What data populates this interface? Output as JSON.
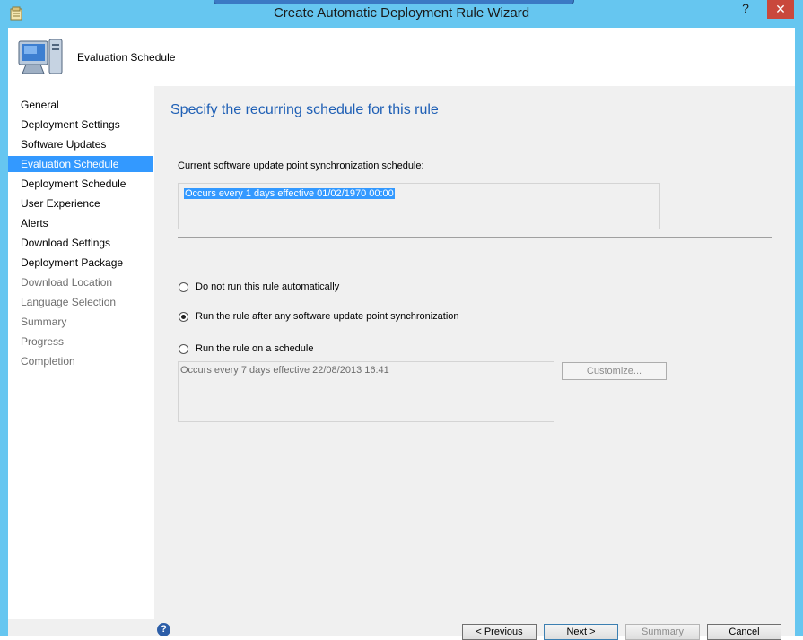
{
  "window": {
    "title": "Create Automatic Deployment Rule Wizard",
    "help_glyph": "?",
    "close_glyph": "✕",
    "frame_color": "#66c6f0",
    "accent_color": "#3399ff"
  },
  "header": {
    "title": "Evaluation Schedule",
    "icon": "computer-icon"
  },
  "nav": {
    "items": [
      {
        "label": "General",
        "state": "enabled"
      },
      {
        "label": "Deployment Settings",
        "state": "enabled"
      },
      {
        "label": "Software Updates",
        "state": "enabled"
      },
      {
        "label": "Evaluation Schedule",
        "state": "selected"
      },
      {
        "label": "Deployment Schedule",
        "state": "enabled"
      },
      {
        "label": "User Experience",
        "state": "enabled"
      },
      {
        "label": "Alerts",
        "state": "enabled"
      },
      {
        "label": "Download Settings",
        "state": "enabled"
      },
      {
        "label": "Deployment Package",
        "state": "enabled"
      },
      {
        "label": "Download Location",
        "state": "disabled"
      },
      {
        "label": "Language Selection",
        "state": "disabled"
      },
      {
        "label": "Summary",
        "state": "disabled"
      },
      {
        "label": "Progress",
        "state": "disabled"
      },
      {
        "label": "Completion",
        "state": "disabled"
      }
    ]
  },
  "main": {
    "heading": "Specify the recurring schedule for this rule",
    "sync_label": "Current software update point synchronization schedule:",
    "sync_value": "Occurs every 1 days effective 01/02/1970 00:00",
    "options": [
      {
        "label": "Do not run this rule automatically",
        "checked": false
      },
      {
        "label": "Run the rule after any software update point synchronization",
        "checked": true
      },
      {
        "label": "Run the rule on a schedule",
        "checked": false
      }
    ],
    "schedule_value": "Occurs every 7 days effective 22/08/2013 16:41",
    "customize_label": "Customize..."
  },
  "footer": {
    "help_glyph": "?",
    "previous_label": "< Previous",
    "next_label": "Next >",
    "summary_label": "Summary",
    "cancel_label": "Cancel"
  }
}
